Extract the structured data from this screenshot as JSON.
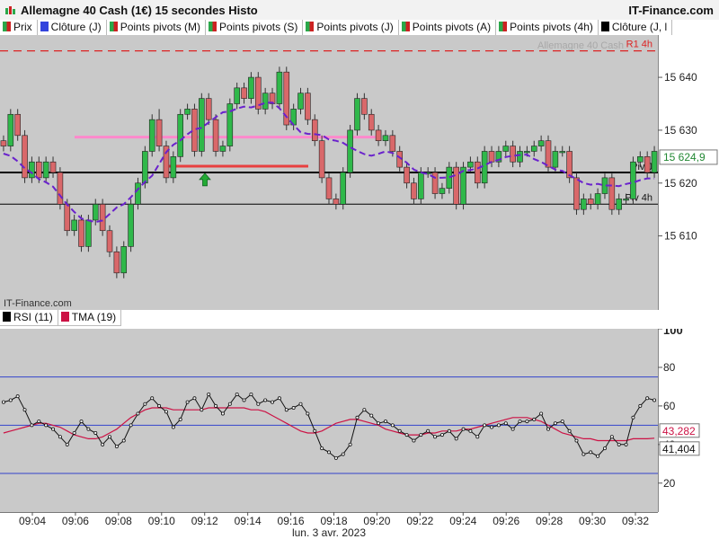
{
  "header": {
    "title": "Allemagne 40 Cash (1€) 15 secondes Histo",
    "brand": "IT-Finance.com"
  },
  "legend": [
    {
      "label": "Prix",
      "swatch": "split"
    },
    {
      "label": "Clôture (J)",
      "swatch": "#3344dd"
    },
    {
      "label": "Points pivots (M)",
      "swatch": "split"
    },
    {
      "label": "Points pivots (S)",
      "swatch": "split"
    },
    {
      "label": "Points pivots (J)",
      "swatch": "split"
    },
    {
      "label": "Points pivots (A)",
      "swatch": "split"
    },
    {
      "label": "Points pivots (4h)",
      "swatch": "split"
    },
    {
      "label": "Clôture (J, l",
      "swatch": "black"
    }
  ],
  "watermark": "IT-Finance.com",
  "instrument_label": "Allemagne 40 Cash",
  "rsi_legend": [
    {
      "label": "RSI (11)",
      "swatch": "#000000"
    },
    {
      "label": "TMA (19)",
      "swatch": "#cc1144"
    }
  ],
  "colors": {
    "up": "#2fb84a",
    "down": "#d9686a",
    "ma": "#6a22cc",
    "pink": "#ff88cc",
    "red_level": "#e84040",
    "r1": "#dd2222",
    "arrow": "#22aa33",
    "rsi": "#111111",
    "tma": "#cc1144",
    "rsi_band": "#3344cc"
  },
  "chart_data": [
    {
      "type": "candlestick",
      "title": "Allemagne 40 Cash (1€) 15 secondes Histo",
      "ylim": [
        15596,
        15648
      ],
      "y_ticks": [
        15610,
        15620,
        15630,
        15640
      ],
      "y_tick_labels": [
        "15 610",
        "15 620",
        "15 630",
        "15 640"
      ],
      "x_tick_labels": [
        "09:04",
        "09:06",
        "09:08",
        "09:10",
        "09:12",
        "09:14",
        "09:16",
        "09:18",
        "09:20",
        "09:22",
        "09:24",
        "09:26",
        "09:28",
        "09:30",
        "09:32"
      ],
      "date_label": "lun. 3 avr. 2023",
      "current_price_label": "15 624,9",
      "current_price": 15624.9,
      "levels": [
        {
          "name": "R1 4h",
          "label": "R1 4h",
          "value": 15645,
          "style": "dashed"
        },
        {
          "name": "Piv J",
          "label": "Piv J",
          "value": 15622,
          "style": "solid-thick"
        },
        {
          "name": "Piv 4h",
          "label": "Piv 4h",
          "value": 15616,
          "style": "solid"
        }
      ],
      "highlight_levels": [
        {
          "name": "pink-level",
          "value": 15628.7
        },
        {
          "name": "red-level",
          "value": 15623.2
        }
      ],
      "series": [
        {
          "name": "Prix",
          "open": [
            15628,
            15627,
            15633,
            15629,
            15621,
            15624,
            15621,
            15624,
            15622,
            15616,
            15611,
            15613,
            15608,
            15613,
            15616,
            15611,
            15607,
            15603,
            15608,
            15616,
            15620,
            15626,
            15632,
            15627,
            15621,
            15625,
            15633,
            15634,
            15626,
            15636,
            15632,
            15626,
            15627,
            15635,
            15638,
            15636,
            15640,
            15634,
            15637,
            15635,
            15641,
            15631,
            15634,
            15637,
            15632,
            15628,
            15621,
            15617,
            15616,
            15622,
            15630,
            15636,
            15633,
            15630,
            15628,
            15629,
            15626,
            15623,
            15620,
            15617,
            15622,
            15622,
            15618,
            15619,
            15623,
            15616,
            15623,
            15624,
            15620,
            15626,
            15624,
            15626,
            15627,
            15624,
            15626,
            15626,
            15627,
            15628,
            15623,
            15626,
            15626,
            15621,
            15615,
            15617,
            15616,
            15618,
            15621,
            15615,
            15617,
            15617,
            15624,
            15625,
            15622
          ],
          "close": [
            15627,
            15633,
            15629,
            15621,
            15624,
            15621,
            15624,
            15622,
            15616,
            15611,
            15613,
            15608,
            15613,
            15616,
            15611,
            15607,
            15603,
            15608,
            15616,
            15620,
            15626,
            15632,
            15627,
            15621,
            15625,
            15633,
            15634,
            15626,
            15636,
            15632,
            15626,
            15627,
            15635,
            15638,
            15636,
            15640,
            15634,
            15637,
            15635,
            15641,
            15631,
            15634,
            15637,
            15632,
            15628,
            15621,
            15617,
            15616,
            15622,
            15630,
            15636,
            15633,
            15630,
            15628,
            15629,
            15626,
            15623,
            15620,
            15617,
            15622,
            15622,
            15618,
            15619,
            15623,
            15616,
            15623,
            15624,
            15620,
            15626,
            15624,
            15626,
            15627,
            15624,
            15626,
            15626,
            15627,
            15628,
            15623,
            15626,
            15626,
            15621,
            15615,
            15617,
            15616,
            15618,
            15621,
            15615,
            15617,
            15617,
            15624,
            15625,
            15622,
            15626
          ],
          "high": [
            15629,
            15634,
            15634,
            15630,
            15625,
            15625,
            15625,
            15625,
            15623,
            15617,
            15614,
            15614,
            15614,
            15617,
            15617,
            15612,
            15608,
            15609,
            15617,
            15621,
            15627,
            15633,
            15634,
            15628,
            15626,
            15634,
            15635,
            15635,
            15637,
            15637,
            15633,
            15628,
            15636,
            15639,
            15639,
            15641,
            15641,
            15638,
            15638,
            15642,
            15642,
            15635,
            15638,
            15638,
            15633,
            15629,
            15622,
            15618,
            15623,
            15631,
            15637,
            15637,
            15634,
            15631,
            15630,
            15630,
            15627,
            15624,
            15621,
            15623,
            15623,
            15623,
            15620,
            15624,
            15624,
            15624,
            15625,
            15625,
            15627,
            15627,
            15627,
            15628,
            15628,
            15627,
            15627,
            15628,
            15629,
            15629,
            15627,
            15627,
            15627,
            15622,
            15618,
            15618,
            15619,
            15622,
            15622,
            15618,
            15618,
            15625,
            15626,
            15626,
            15627
          ],
          "low": [
            15626,
            15626,
            15628,
            15620,
            15620,
            15620,
            15620,
            15621,
            15615,
            15610,
            15610,
            15607,
            15607,
            15612,
            15610,
            15606,
            15602,
            15602,
            15607,
            15615,
            15619,
            15625,
            15626,
            15620,
            15620,
            15624,
            15632,
            15625,
            15625,
            15631,
            15625,
            15625,
            15626,
            15634,
            15635,
            15635,
            15633,
            15633,
            15634,
            15634,
            15630,
            15630,
            15633,
            15631,
            15627,
            15620,
            15616,
            15615,
            15615,
            15621,
            15629,
            15632,
            15629,
            15627,
            15627,
            15625,
            15622,
            15619,
            15616,
            15616,
            15621,
            15617,
            15617,
            15618,
            15615,
            15615,
            15622,
            15619,
            15619,
            15623,
            15623,
            15625,
            15623,
            15623,
            15625,
            15625,
            15626,
            15622,
            15622,
            15625,
            15620,
            15614,
            15614,
            15615,
            15615,
            15617,
            15614,
            15614,
            15616,
            15616,
            15623,
            15621,
            15621
          ]
        }
      ]
    },
    {
      "type": "line",
      "title": "RSI (11)",
      "ylim": [
        5,
        100
      ],
      "y_ticks": [
        20,
        40,
        60,
        80,
        100
      ],
      "y_tick_labels": [
        "20",
        "40",
        "60",
        "80",
        "100"
      ],
      "bands": [
        75,
        50,
        25
      ],
      "last_value_labels": [
        {
          "series": "TMA (19)",
          "label": "43,282",
          "value": 43.282
        },
        {
          "series": "RSI (11)",
          "label": "41,404",
          "value": 41.404
        }
      ],
      "series": [
        {
          "name": "RSI (11)",
          "values": [
            62,
            63,
            65,
            58,
            50,
            52,
            50,
            48,
            44,
            40,
            46,
            52,
            48,
            46,
            40,
            44,
            39,
            42,
            50,
            56,
            61,
            64,
            60,
            57,
            49,
            53,
            62,
            64,
            58,
            66,
            60,
            56,
            61,
            66,
            63,
            66,
            61,
            63,
            62,
            64,
            58,
            59,
            61,
            56,
            47,
            38,
            36,
            33,
            35,
            40,
            54,
            58,
            55,
            51,
            52,
            50,
            47,
            45,
            42,
            45,
            47,
            44,
            45,
            47,
            43,
            48,
            47,
            44,
            50,
            49,
            50,
            51,
            48,
            52,
            52,
            53,
            56,
            48,
            51,
            52,
            47,
            42,
            35,
            36,
            34,
            38,
            44,
            40,
            40,
            54,
            60,
            64,
            63
          ]
        },
        {
          "name": "TMA (19)",
          "values": [
            46,
            47,
            48,
            49,
            50,
            51,
            51,
            50,
            49,
            47,
            45,
            44,
            43,
            43,
            44,
            46,
            48,
            51,
            54,
            56,
            58,
            59,
            59,
            59,
            58,
            58,
            58,
            58,
            58,
            59,
            59,
            59,
            59,
            59,
            59,
            58,
            58,
            57,
            55,
            53,
            51,
            49,
            47,
            46,
            46,
            47,
            49,
            51,
            52,
            53,
            53,
            52,
            51,
            50,
            48,
            47,
            46,
            45,
            45,
            45,
            46,
            46,
            47,
            47,
            47,
            48,
            48,
            49,
            50,
            51,
            52,
            53,
            54,
            54,
            54,
            53,
            52,
            50,
            48,
            46,
            45,
            44,
            43,
            43,
            42,
            42,
            42,
            42,
            42,
            43,
            43,
            43,
            43.3
          ]
        }
      ]
    }
  ]
}
